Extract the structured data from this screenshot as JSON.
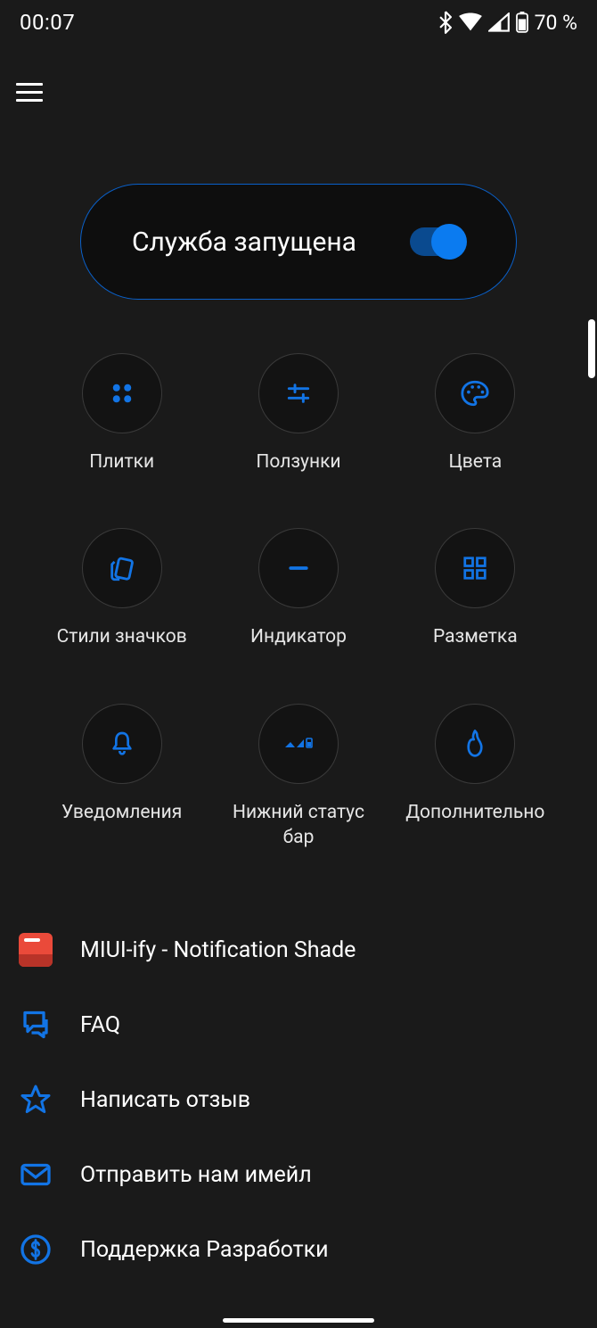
{
  "status_bar": {
    "time": "00:07",
    "battery_text": "70 %"
  },
  "service": {
    "label": "Служба запущена",
    "enabled": true
  },
  "grid": [
    {
      "icon": "tiles",
      "label": "Плитки"
    },
    {
      "icon": "sliders",
      "label": "Ползунки"
    },
    {
      "icon": "palette",
      "label": "Цвета"
    },
    {
      "icon": "icon-styles",
      "label": "Стили значков"
    },
    {
      "icon": "indicator",
      "label": "Индикатор"
    },
    {
      "icon": "layout",
      "label": "Разметка"
    },
    {
      "icon": "bell",
      "label": "Уведомления"
    },
    {
      "icon": "status-bar",
      "label": "Нижний статус\nбар"
    },
    {
      "icon": "fire",
      "label": "Дополнительно"
    }
  ],
  "list": [
    {
      "icon": "app",
      "label": "MIUI-ify - Notification Shade"
    },
    {
      "icon": "faq",
      "label": "FAQ"
    },
    {
      "icon": "star",
      "label": "Написать отзыв"
    },
    {
      "icon": "mail",
      "label": "Отправить нам имейл"
    },
    {
      "icon": "dollar",
      "label": "Поддержка Разработки"
    }
  ],
  "colors": {
    "accent": "#1274e5",
    "background": "#1a1a1a"
  }
}
